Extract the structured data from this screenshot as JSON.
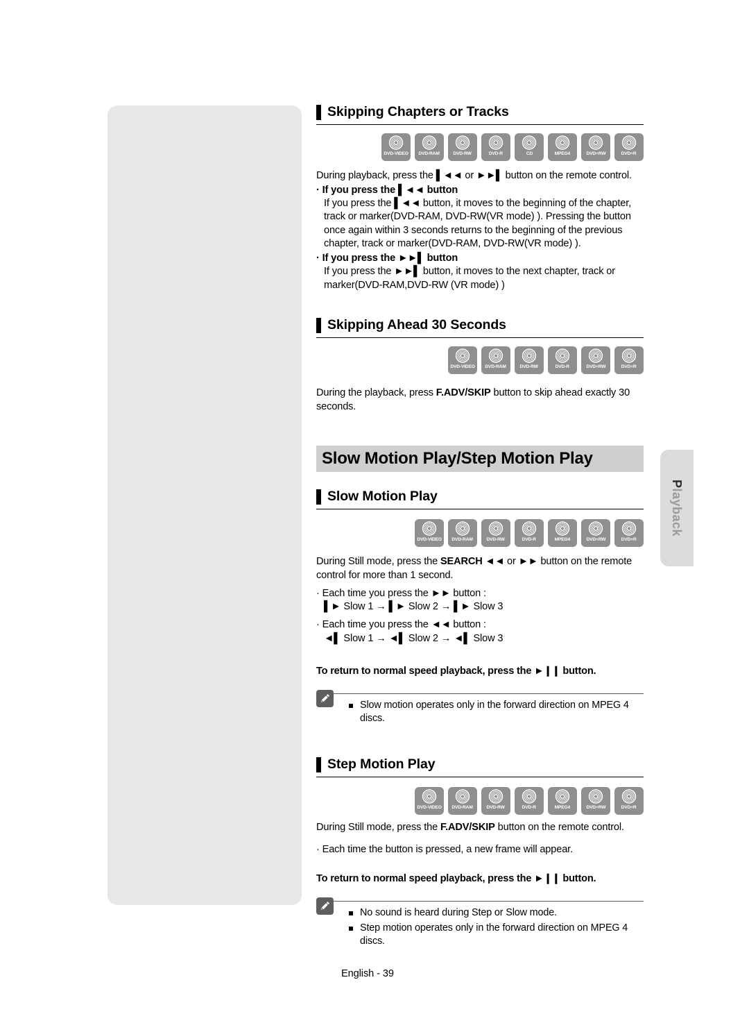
{
  "page": {
    "footer": "English - 39",
    "side_tab": {
      "label": "Playback",
      "first_letter": "P",
      "rest": "layback"
    }
  },
  "colors": {
    "panel_gray": "#e7e7e7",
    "banner_gray": "#cfcfcf",
    "disc_icon_gray": "#8f8f8f",
    "note_icon_gray": "#5e5e5e",
    "tab_gray": "#dcdcdc",
    "text_black": "#000000"
  },
  "disc_icon_labels": {
    "dvd_video": "DVD-VIDEO",
    "dvd_ram": "DVD-RAM",
    "dvd_rw": "DVD-RW",
    "dvd_r": "DVD-R",
    "cd": "CD",
    "mpeg4": "MPEG4",
    "dvd_plus_rw": "DVD+RW",
    "dvd_plus_r": "DVD+R"
  },
  "sections": {
    "skipping_chapters": {
      "heading": "Skipping Chapters or Tracks",
      "discs": [
        "DVD-VIDEO",
        "DVD-RAM",
        "DVD-RW",
        "DVD-R",
        "CD",
        "MPEG4",
        "DVD+RW",
        "DVD+R"
      ],
      "intro_pre": "During playback, press the ",
      "intro_glyph_1": "▌◄◄",
      "intro_mid": " or ",
      "intro_glyph_2": "►►▌",
      "intro_post": " button on the remote control.",
      "bullet_1": {
        "head_pre": "· If you press the ",
        "head_glyph": "▌◄◄",
        "head_post": " button",
        "body_pre": "If you press the ",
        "body_glyph": "▌◄◄",
        "body_post": " button, it moves to the beginning of the chapter, track or marker(DVD-RAM, DVD-RW(VR mode) ). Pressing the button once again within 3 seconds returns to the beginning of the previous chapter, track or marker(DVD-RAM, DVD-RW(VR mode) )."
      },
      "bullet_2": {
        "head_pre": "· If you press the ",
        "head_glyph": "►►▌",
        "head_post": " button",
        "body_pre": "If you press the ",
        "body_glyph": "►►▌",
        "body_post": " button, it moves to the next chapter, track or marker(DVD-RAM,DVD-RW (VR mode) )"
      }
    },
    "skipping_ahead": {
      "heading": "Skipping Ahead 30 Seconds",
      "discs": [
        "DVD-VIDEO",
        "DVD-RAM",
        "DVD-RW",
        "DVD-R",
        "DVD+RW",
        "DVD+R"
      ],
      "body_pre": "During the playback, press ",
      "body_bold": "F.ADV/SKIP",
      "body_post": " button to skip ahead exactly 30 seconds."
    },
    "slow_step_banner": {
      "title": "Slow Motion Play/Step Motion Play"
    },
    "slow_motion": {
      "heading": "Slow Motion Play",
      "discs": [
        "DVD-VIDEO",
        "DVD-RAM",
        "DVD-RW",
        "DVD-R",
        "MPEG4",
        "DVD+RW",
        "DVD+R"
      ],
      "intro_pre": "During Still mode, press the ",
      "intro_bold": "SEARCH",
      "intro_glyph_1": " ◄◄",
      "intro_mid": " or ",
      "intro_glyph_2": "►►",
      "intro_post": " button on the remote control for more than 1 second.",
      "item_1_head_pre": "· Each time you press the ",
      "item_1_head_glyph": "►►",
      "item_1_head_post": " button :",
      "item_1_seq": "▌► Slow 1 → ▌► Slow 2 → ▌► Slow 3",
      "item_2_head_pre": "· Each time you press the ",
      "item_2_head_glyph": "◄◄",
      "item_2_head_post": " button :",
      "item_2_seq": "◄▌ Slow 1 → ◄▌ Slow 2 → ◄▌ Slow 3",
      "return_pre": "To return to normal speed playback, press the ",
      "return_glyph": "►❙❙",
      "return_post": " button.",
      "notes": [
        "Slow motion operates only in the forward direction on MPEG 4 discs."
      ]
    },
    "step_motion": {
      "heading": "Step Motion Play",
      "discs": [
        "DVD-VIDEO",
        "DVD-RAM",
        "DVD-RW",
        "DVD-R",
        "MPEG4",
        "DVD+RW",
        "DVD+R"
      ],
      "intro_pre": "During Still mode, press the ",
      "intro_bold": "F.ADV/SKIP",
      "intro_post": " button on the remote control.",
      "item_1": "· Each time the button is pressed, a new frame will appear.",
      "return_pre": "To return to normal speed playback, press the ",
      "return_glyph": "►❙❙",
      "return_post": " button.",
      "notes": [
        "No sound is heard during Step or Slow mode.",
        "Step motion operates only in the forward direction on MPEG 4 discs."
      ]
    }
  }
}
